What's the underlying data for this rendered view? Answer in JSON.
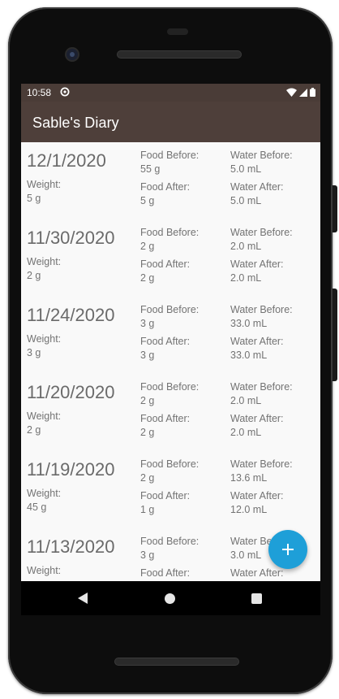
{
  "status_bar": {
    "time": "10:58"
  },
  "app_bar": {
    "title": "Sable's Diary"
  },
  "labels": {
    "weight": "Weight:",
    "food_before": "Food Before:",
    "food_after": "Food After:",
    "water_before": "Water Before:",
    "water_after": "Water After:"
  },
  "entries": [
    {
      "date": "12/1/2020",
      "weight": "5 g",
      "food_before": "55 g",
      "food_after": "5 g",
      "water_before": "5.0 mL",
      "water_after": "5.0 mL"
    },
    {
      "date": "11/30/2020",
      "weight": "2 g",
      "food_before": "2 g",
      "food_after": "2 g",
      "water_before": "2.0 mL",
      "water_after": "2.0 mL"
    },
    {
      "date": "11/24/2020",
      "weight": "3 g",
      "food_before": "3 g",
      "food_after": "3 g",
      "water_before": "33.0 mL",
      "water_after": "33.0 mL"
    },
    {
      "date": "11/20/2020",
      "weight": "2 g",
      "food_before": "2 g",
      "food_after": "2 g",
      "water_before": "2.0 mL",
      "water_after": "2.0 mL"
    },
    {
      "date": "11/19/2020",
      "weight": "45 g",
      "food_before": "2 g",
      "food_after": "1 g",
      "water_before": "13.6 mL",
      "water_after": "12.0 mL"
    },
    {
      "date": "11/13/2020",
      "weight": "",
      "food_before": "3 g",
      "food_after": "",
      "water_before": "3.0 mL",
      "water_after": ""
    }
  ],
  "fab": {
    "icon": "plus-icon",
    "color": "#1e9fd8"
  },
  "colors": {
    "app_bar": "#4e3f3a",
    "status_bar": "#4a3c37",
    "list_background": "#f9f9f9"
  }
}
